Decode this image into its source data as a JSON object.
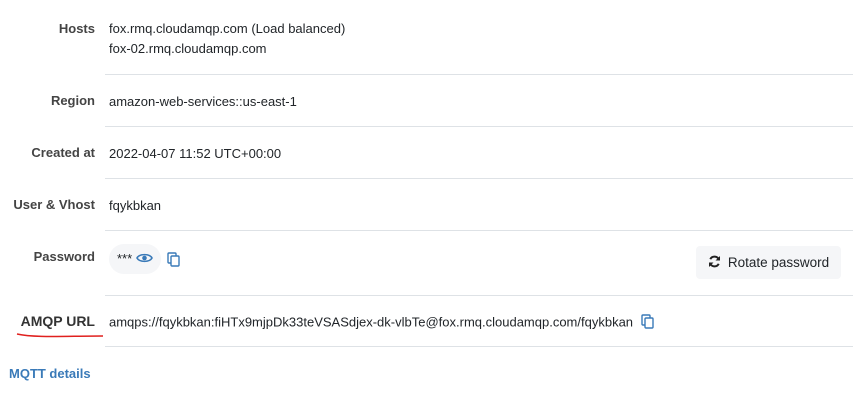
{
  "rows": {
    "hosts": {
      "label": "Hosts",
      "values": [
        "fox.rmq.cloudamqp.com (Load balanced)",
        "fox-02.rmq.cloudamqp.com"
      ]
    },
    "region": {
      "label": "Region",
      "value": "amazon-web-services::us-east-1"
    },
    "created": {
      "label": "Created at",
      "value": "2022-04-07 11:52 UTC+00:00"
    },
    "user": {
      "label": "User & Vhost",
      "value": "fqykbkan"
    },
    "password": {
      "label": "Password",
      "value": "***",
      "rotate_label": "Rotate password"
    },
    "amqp": {
      "label": "AMQP URL",
      "value": "amqps://fqykbkan:fiHTx9mjpDk33teVSASdjex-dk-vlbTe@fox.rmq.cloudamqp.com/fqykbkan"
    }
  },
  "mqtt_link": "MQTT details",
  "colors": {
    "link": "#3a7ab8",
    "annotation": "#e0201e"
  }
}
